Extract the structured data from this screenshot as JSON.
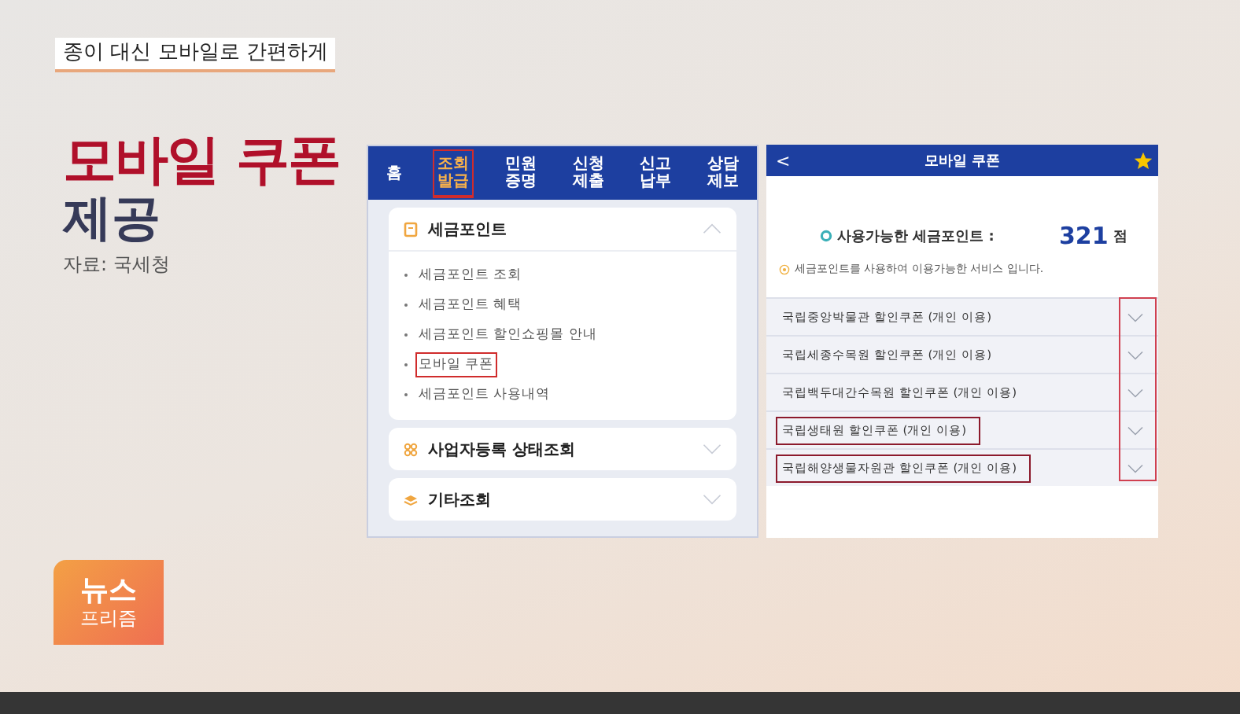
{
  "caption": "종이 대신 모바일로 간편하게",
  "headline": {
    "accent": "모바일 쿠폰",
    "rest": "제공",
    "source": "자료: 국세청"
  },
  "left_screen": {
    "tabs": [
      {
        "label": "홈",
        "selected": false,
        "highlighted": false
      },
      {
        "label": "조회\n발급",
        "selected": true,
        "highlighted": true
      },
      {
        "label": "민원\n증명",
        "selected": false,
        "highlighted": false
      },
      {
        "label": "신청\n제출",
        "selected": false,
        "highlighted": false
      },
      {
        "label": "신고\n납부",
        "selected": false,
        "highlighted": false
      },
      {
        "label": "상담\n제보",
        "selected": false,
        "highlighted": false
      }
    ],
    "sections": [
      {
        "title": "세금포인트",
        "kind": "note",
        "expanded": true,
        "items": [
          {
            "label": "세금포인트 조회",
            "highlighted": false
          },
          {
            "label": "세금포인트 혜택",
            "highlighted": false
          },
          {
            "label": "세금포인트 할인쇼핑몰 안내",
            "highlighted": false
          },
          {
            "label": "모바일 쿠폰",
            "highlighted": true
          },
          {
            "label": "세금포인트 사용내역",
            "highlighted": false
          }
        ]
      },
      {
        "title": "사업자등록 상태조회",
        "kind": "grid",
        "expanded": false
      },
      {
        "title": "기타조회",
        "kind": "stack",
        "expanded": false
      }
    ]
  },
  "right_screen": {
    "back": "<",
    "title": "모바일 쿠폰",
    "favorite": true,
    "points_label": "사용가능한 세금포인트 :",
    "points_value": "321",
    "points_unit": "점",
    "note": "세금포인트를 사용하여 이용가능한 서비스 입니다.",
    "chevrons_highlighted": true,
    "coupons": [
      {
        "label": "국립중앙박물관 할인쿠폰 (개인 이용)",
        "highlighted": false
      },
      {
        "label": "국립세종수목원 할인쿠폰 (개인 이용)",
        "highlighted": false
      },
      {
        "label": "국립백두대간수목원 할인쿠폰 (개인 이용)",
        "highlighted": false
      },
      {
        "label": "국립생태원 할인쿠폰 (개인 이용)",
        "highlighted": true
      },
      {
        "label": "국립해양생물자원관 할인쿠폰 (개인 이용)",
        "highlighted": true
      }
    ]
  },
  "logo": {
    "top": "뉴스",
    "bottom": "프리즘"
  }
}
